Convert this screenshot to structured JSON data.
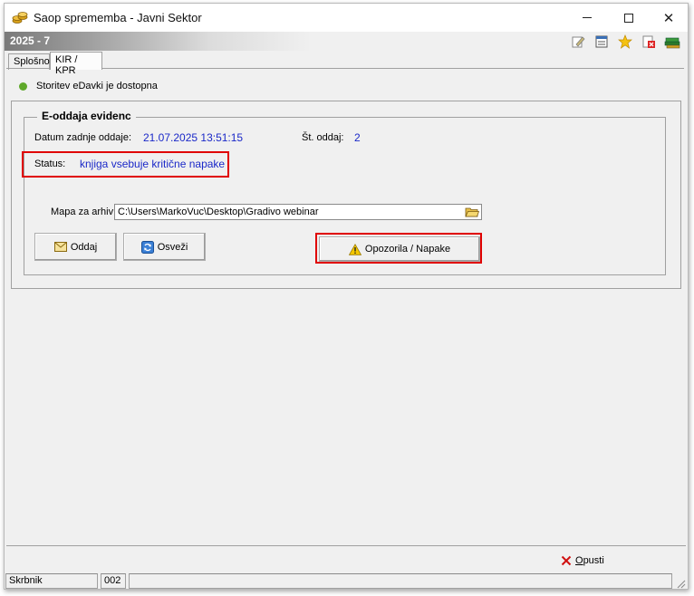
{
  "window": {
    "title": "Saop sprememba - Javni Sektor",
    "period": "2025 - 7"
  },
  "toolbar": {
    "icons": [
      "edit-icon",
      "list-icon",
      "star-icon",
      "delete-icon",
      "books-icon"
    ]
  },
  "tabs": [
    {
      "label": "Splošno",
      "active": false
    },
    {
      "label": "KIR / KPR",
      "active": true
    }
  ],
  "service": {
    "text": "Storitev eDavki je dostopna",
    "status_color": "#5fa82b"
  },
  "eoddaja": {
    "title": "E-oddaja evidenc",
    "last_date_label": "Datum zadnje oddaje:",
    "last_date_value": "21.07.2025 13:51:15",
    "count_label": "Št. oddaj:",
    "count_value": "2",
    "status_label": "Status:",
    "status_value": "knjiga vsebuje kritične napake",
    "archive_label": "Mapa za arhiv",
    "archive_path": "C:\\Users\\MarkoVuc\\Desktop\\Gradivo webinar",
    "buttons": {
      "oddaj": "Oddaj",
      "osvezi": "Osveži",
      "opozorila": "Opozorila / Napake"
    }
  },
  "footer": {
    "cancel_label_underlined": "O",
    "cancel_label_rest": "pusti"
  },
  "statusbar": {
    "user": "Skrbnik",
    "code": "002",
    "extra": ""
  },
  "colors": {
    "value_text": "#1a28c8",
    "highlight_box": "#e00000",
    "accent_gradient_start": "#7a7a7a"
  }
}
